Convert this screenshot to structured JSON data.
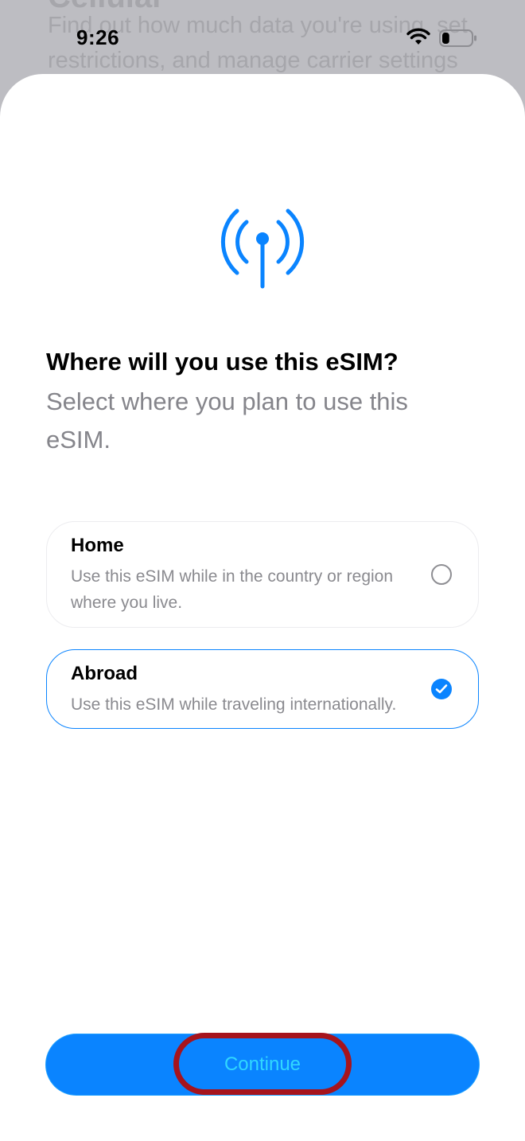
{
  "background_page": {
    "heading": "Cellular",
    "text": "Find out how much data you're using, set restrictions, and manage carrier settings such"
  },
  "status_bar": {
    "time": "9:26",
    "wifi_icon": "wifi-icon",
    "battery_icon": "battery-icon",
    "battery_level": 0.25
  },
  "sheet": {
    "icon": "antenna-signal-icon",
    "accent_color": "#0a84ff",
    "title": "Where will you use this eSIM?",
    "subtitle": "Select where you plan to use this eSIM.",
    "options": [
      {
        "title": "Home",
        "description": "Use this eSIM while in the country or region where you live.",
        "selected": false
      },
      {
        "title": "Abroad",
        "description": "Use this eSIM while traveling internationally.",
        "selected": true
      }
    ],
    "continue_label": "Continue"
  }
}
